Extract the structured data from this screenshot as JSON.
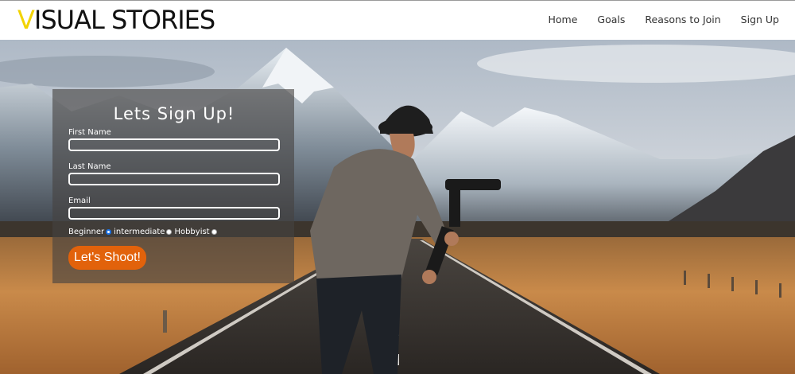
{
  "brand": {
    "first_letter": "V",
    "rest": "ISUAL STORIES",
    "accent_color": "#f2d300"
  },
  "nav": {
    "items": [
      {
        "label": "Home"
      },
      {
        "label": "Goals"
      },
      {
        "label": "Reasons to Join"
      },
      {
        "label": "Sign Up"
      }
    ]
  },
  "form": {
    "title": "Lets Sign Up!",
    "first_name_label": "First Name",
    "first_name_value": "",
    "last_name_label": "Last Name",
    "last_name_value": "",
    "email_label": "Email",
    "email_value": "",
    "levels": [
      {
        "label": "Beginner",
        "checked": true
      },
      {
        "label": "intermediate",
        "checked": false
      },
      {
        "label": "Hobbyist",
        "checked": false
      }
    ],
    "submit_label": "Let's Shoot!",
    "submit_color": "#e2620b"
  },
  "hero": {
    "image_icon": "photographer-with-gimbal-on-mountain-road"
  }
}
